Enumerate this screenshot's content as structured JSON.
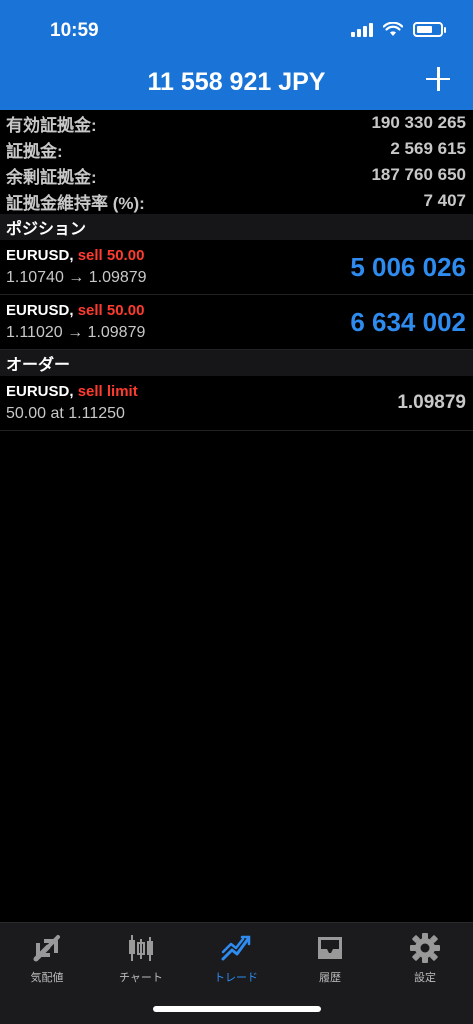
{
  "status_bar": {
    "time": "10:59"
  },
  "header": {
    "title": "11 558 921 JPY"
  },
  "summary": [
    {
      "label": "有効証拠金:",
      "value": "190 330 265"
    },
    {
      "label": "証拠金:",
      "value": "2 569 615"
    },
    {
      "label": "余剰証拠金:",
      "value": "187 760 650"
    },
    {
      "label": "証拠金維持率 (%):",
      "value": "7 407"
    }
  ],
  "positions": {
    "title": "ポジション",
    "items": [
      {
        "symbol": "EURUSD,",
        "action": "sell 50.00",
        "prices": "1.10740 → 1.09879",
        "profit": "5 006 026"
      },
      {
        "symbol": "EURUSD,",
        "action": "sell 50.00",
        "prices": "1.11020 → 1.09879",
        "profit": "6 634 002"
      }
    ]
  },
  "orders": {
    "title": "オーダー",
    "items": [
      {
        "symbol": "EURUSD,",
        "action": "sell limit",
        "detail": "50.00 at 1.11250",
        "price": "1.09879"
      }
    ]
  },
  "tabbar": [
    {
      "label": "気配値",
      "icon": "quotes-icon"
    },
    {
      "label": "チャート",
      "icon": "chart-icon"
    },
    {
      "label": "トレード",
      "icon": "trade-icon",
      "active": true
    },
    {
      "label": "履歴",
      "icon": "history-icon"
    },
    {
      "label": "設定",
      "icon": "settings-icon"
    }
  ],
  "colors": {
    "accent": "#2e8cf0",
    "header": "#1a73d6",
    "sell": "#ff3b30"
  }
}
